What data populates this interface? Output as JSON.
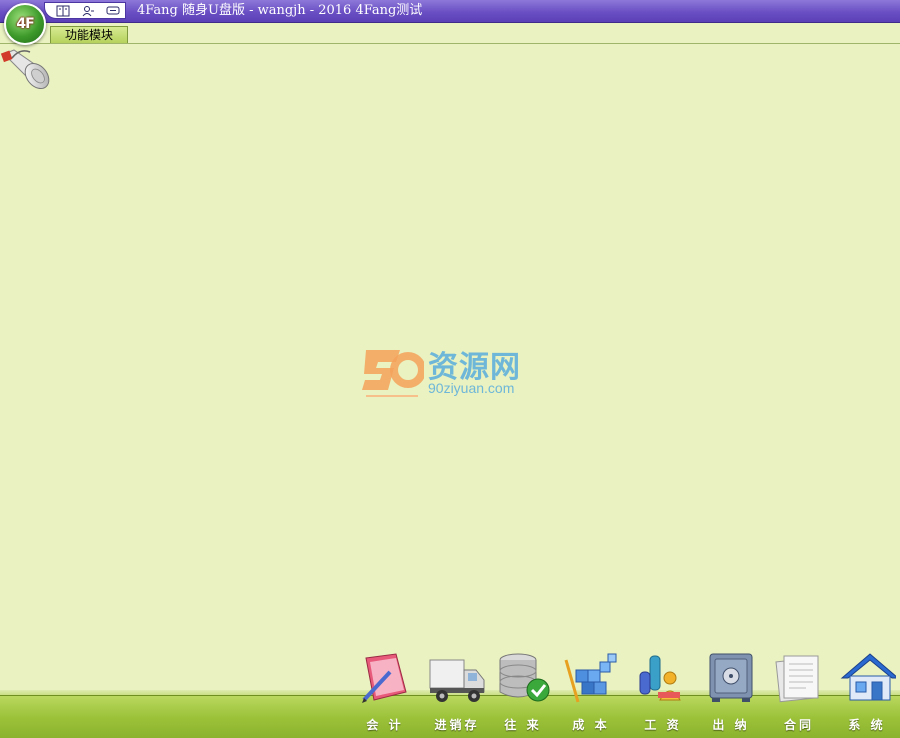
{
  "titlebar": {
    "title": "4Fang 随身U盘版  - wangjh - 2016 4Fang测试",
    "logo_text": "4F",
    "quick_tools": [
      "book-icon",
      "user-icon",
      "chat-icon"
    ]
  },
  "tabs": [
    {
      "label": "功能模块",
      "active": true
    }
  ],
  "watermark": {
    "text": "资源网",
    "url": "90ziyuan.com"
  },
  "modules": [
    {
      "label": "会 计",
      "icon": "accounting-icon"
    },
    {
      "label": "进销存",
      "icon": "truck-icon"
    },
    {
      "label": "往 来",
      "icon": "database-check-icon"
    },
    {
      "label": "成 本",
      "icon": "cost-blocks-icon"
    },
    {
      "label": "工 资",
      "icon": "salary-icon"
    },
    {
      "label": "出 纳",
      "icon": "safe-icon"
    },
    {
      "label": "合同",
      "icon": "contract-icon"
    },
    {
      "label": "系 统",
      "icon": "house-icon"
    }
  ],
  "colors": {
    "background": "#e9f2c0",
    "titlebar": "#6a4fc4",
    "bottombar": "#9cc23a",
    "watermark": "#6fb7d9"
  }
}
